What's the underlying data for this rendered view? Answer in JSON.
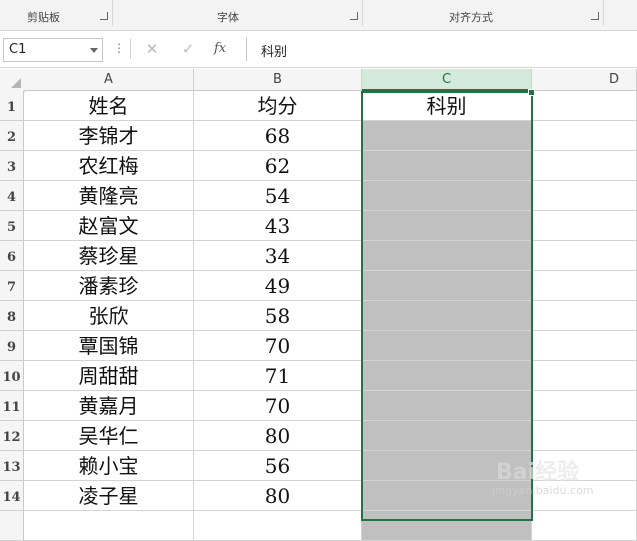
{
  "ribbon": {
    "groups": [
      {
        "label": "剪贴板"
      },
      {
        "label": "字体"
      },
      {
        "label": "对齐方式"
      }
    ]
  },
  "formula_bar": {
    "name_box": "C1",
    "cancel_icon": "✕",
    "enter_icon": "✓",
    "fx_label": "fx",
    "content": "科别"
  },
  "sheet": {
    "columns": [
      "A",
      "B",
      "C",
      "D"
    ],
    "selected_column": "C",
    "rows": [
      {
        "num": "1",
        "a": "姓名",
        "b": "均分",
        "c": "科别"
      },
      {
        "num": "2",
        "a": "李锦才",
        "b": "68",
        "c": ""
      },
      {
        "num": "3",
        "a": "农红梅",
        "b": "62",
        "c": ""
      },
      {
        "num": "4",
        "a": "黄隆亮",
        "b": "54",
        "c": ""
      },
      {
        "num": "5",
        "a": "赵富文",
        "b": "43",
        "c": ""
      },
      {
        "num": "6",
        "a": "蔡珍星",
        "b": "34",
        "c": ""
      },
      {
        "num": "7",
        "a": "潘素珍",
        "b": "49",
        "c": ""
      },
      {
        "num": "8",
        "a": "张欣",
        "b": "58",
        "c": ""
      },
      {
        "num": "9",
        "a": "覃国锦",
        "b": "70",
        "c": ""
      },
      {
        "num": "10",
        "a": "周甜甜",
        "b": "71",
        "c": ""
      },
      {
        "num": "11",
        "a": "黄嘉月",
        "b": "70",
        "c": ""
      },
      {
        "num": "12",
        "a": "吴华仁",
        "b": "80",
        "c": ""
      },
      {
        "num": "13",
        "a": "赖小宝",
        "b": "56",
        "c": ""
      },
      {
        "num": "14",
        "a": "凌子星",
        "b": "80",
        "c": ""
      }
    ]
  },
  "colors": {
    "accent": "#217346",
    "selection_fill": "#c0c0c0"
  }
}
